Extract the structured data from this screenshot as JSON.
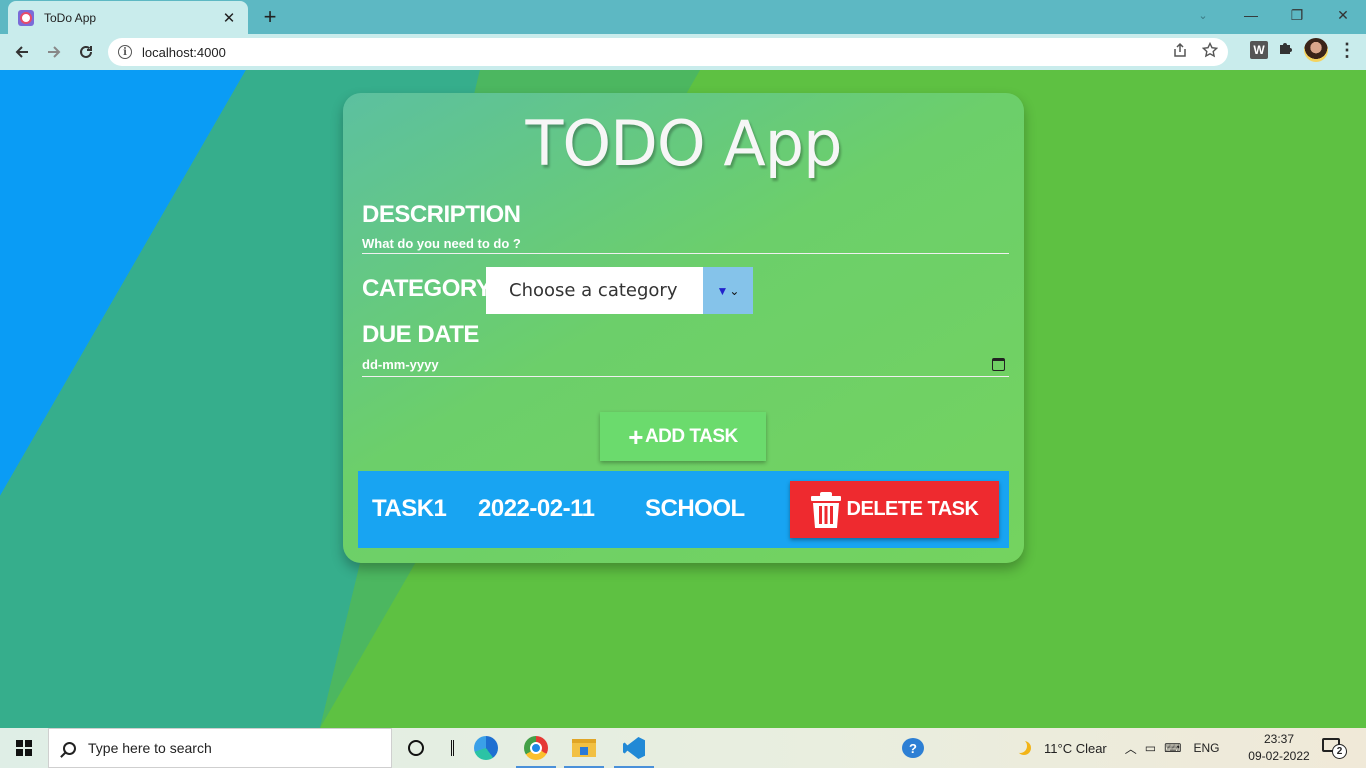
{
  "browser": {
    "tab_title": "ToDo App",
    "tab_close": "✕",
    "new_tab": "+",
    "url": "localhost:4000",
    "minimize": "—",
    "restore": "❐",
    "close": "✕",
    "tab_search": "⌄",
    "extension_w": "W",
    "icons": [
      "back-arrow-icon",
      "forward-arrow-icon",
      "reload-icon",
      "info-icon",
      "share-icon",
      "star-icon",
      "extension-w-icon",
      "puzzle-icon",
      "profile-avatar",
      "kebab-menu-icon"
    ]
  },
  "app": {
    "title": "TODO App",
    "description_label": "DESCRIPTION",
    "description_placeholder": "What do you need to do ?",
    "category_label": "CATEGORY",
    "category_selected": "Choose a category",
    "due_date_label": "DUE DATE",
    "due_date_placeholder": "dd-mm-yyyy",
    "add_button_icon": "+",
    "add_button_label": "ADD TASK",
    "tasks": [
      {
        "name": "TASK1",
        "date": "2022-02-11",
        "category": "SCHOOL",
        "delete_label": "DELETE TASK"
      }
    ],
    "colors": {
      "task_row": "#18a4f2",
      "delete_button": "#ee2a2f",
      "add_button": "#6bdb6d",
      "select_arrow": "#85c3ea"
    }
  },
  "taskbar": {
    "search_placeholder": "Type here to search",
    "weather": "11°C  Clear",
    "language": "ENG",
    "time": "23:37",
    "date": "09-02-2022",
    "notification_count": "2",
    "apps": [
      "edge-icon",
      "chrome-icon",
      "file-explorer-icon",
      "vscode-icon"
    ]
  }
}
